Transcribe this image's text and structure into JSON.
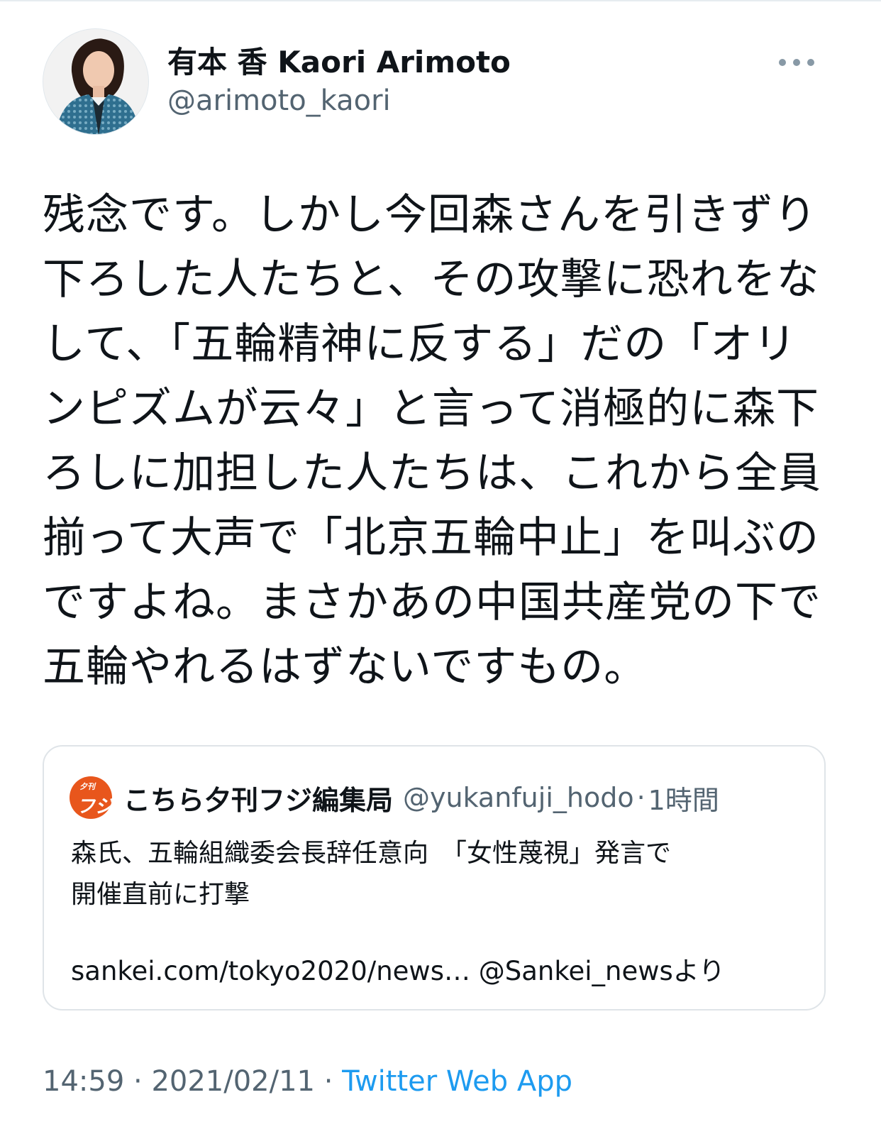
{
  "author": {
    "display_name": "有本 香  Kaori Arimoto",
    "handle": "@arimoto_kaori",
    "avatar_icon": "profile-photo-woman"
  },
  "more_icon": "more-horizontal-icon",
  "tweet": {
    "text": "残念です。しかし今回森さんを引きずり下ろした人たちと、その攻撃に恐れをなして、「五輪精神に反する」だの「オリンピズムが云々」と言って消極的に森下ろしに加担した人たちは、これから全員揃って大声で「北京五輪中止」を叫ぶのですよね。まさかあの中国共産党の下で五輪やれるはずないですもの。"
  },
  "quote": {
    "avatar_text_small": "夕刊",
    "avatar_text_big": "フジ",
    "avatar_color": "#e8561c",
    "name": "こちら夕刊フジ編集局",
    "handle": "@yukanfuji_hodo",
    "separator": "·",
    "time": "1時間",
    "text_line1": "森氏、五輪組織委会長辞任意向　「女性蔑視」発言で",
    "text_line2": "開催直前に打撃",
    "link": "sankei.com/tokyo2020/news… @Sankei_newsより"
  },
  "meta": {
    "time": "14:59",
    "sep1": " · ",
    "date": "2021/02/11",
    "sep2": " · ",
    "source": "Twitter Web App",
    "source_color": "#1d9bf0"
  }
}
